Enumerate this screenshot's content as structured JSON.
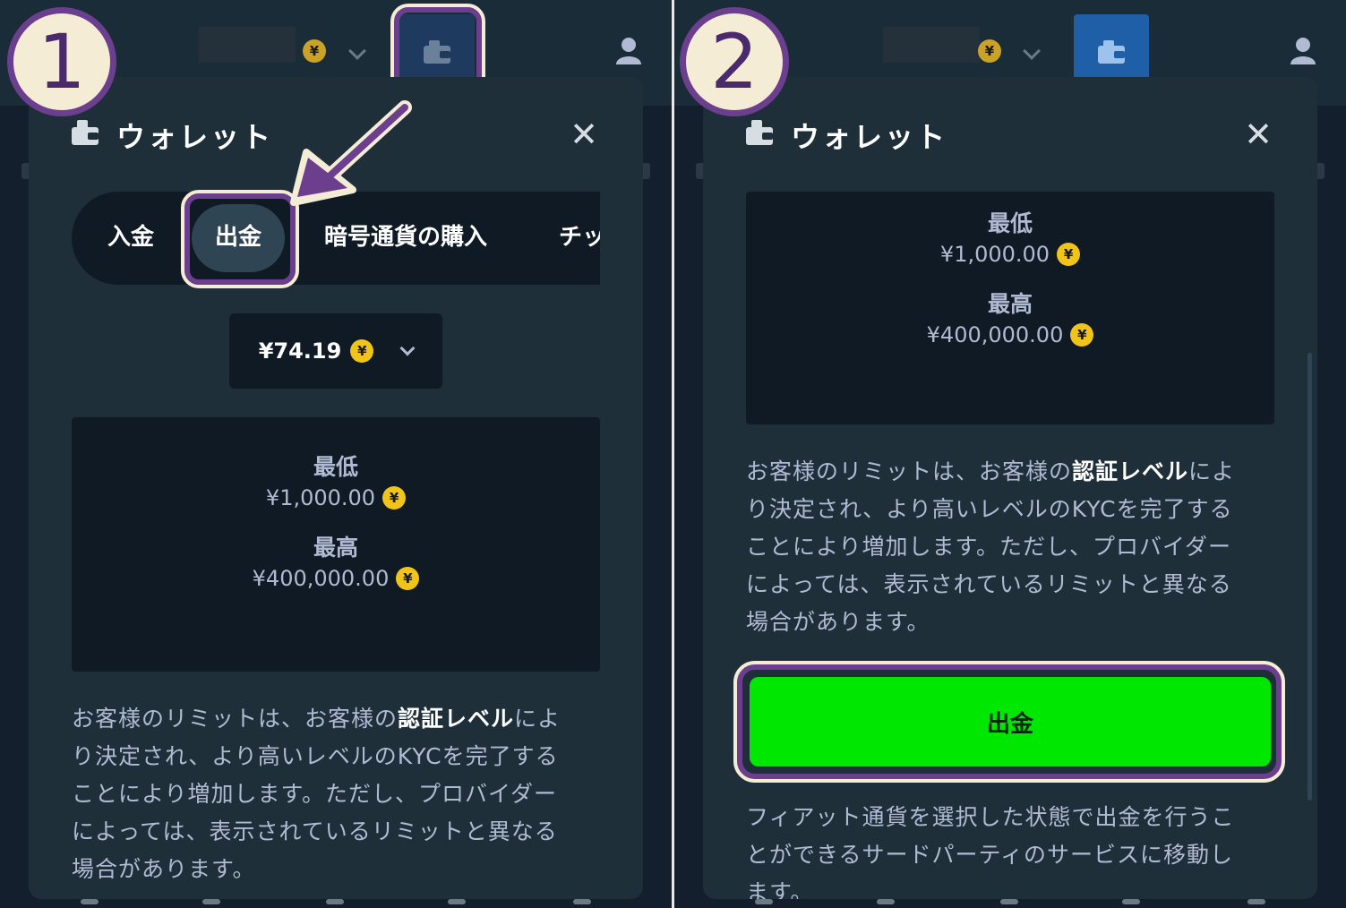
{
  "steps": [
    "1",
    "2"
  ],
  "wallet": {
    "title": "ウォレット",
    "close": "✕",
    "tabs": [
      "入金",
      "出金",
      "暗号通貨の購入",
      "チッ"
    ],
    "balance": "¥74.19",
    "coin_symbol": "¥",
    "limits": {
      "min_label": "最低",
      "min_value": "¥1,000.00",
      "max_label": "最高",
      "max_value": "¥400,000.00"
    },
    "desc_prefix": "お客様のリミットは、お客様の",
    "desc_bold": "認証レベル",
    "desc_line1_end": "によ",
    "desc_lines": [
      "り決定され、より高いレベルのKYCを完了する",
      "ことにより増加します。ただし、プロバイダー",
      "によっては、表示されているリミットと異なる",
      "場合があります。"
    ],
    "withdraw_button": "出金",
    "fiat_note_lines": [
      "フィアット通貨を選択した状態で出金を行うこ",
      "とができるサードパーティのサービスに移動し",
      "ます。"
    ]
  },
  "colors": {
    "accent_green": "#00e701",
    "highlight_purple": "#6b3f8e",
    "highlight_cream": "#f5ecd6",
    "coin_gold": "#f0c419"
  }
}
